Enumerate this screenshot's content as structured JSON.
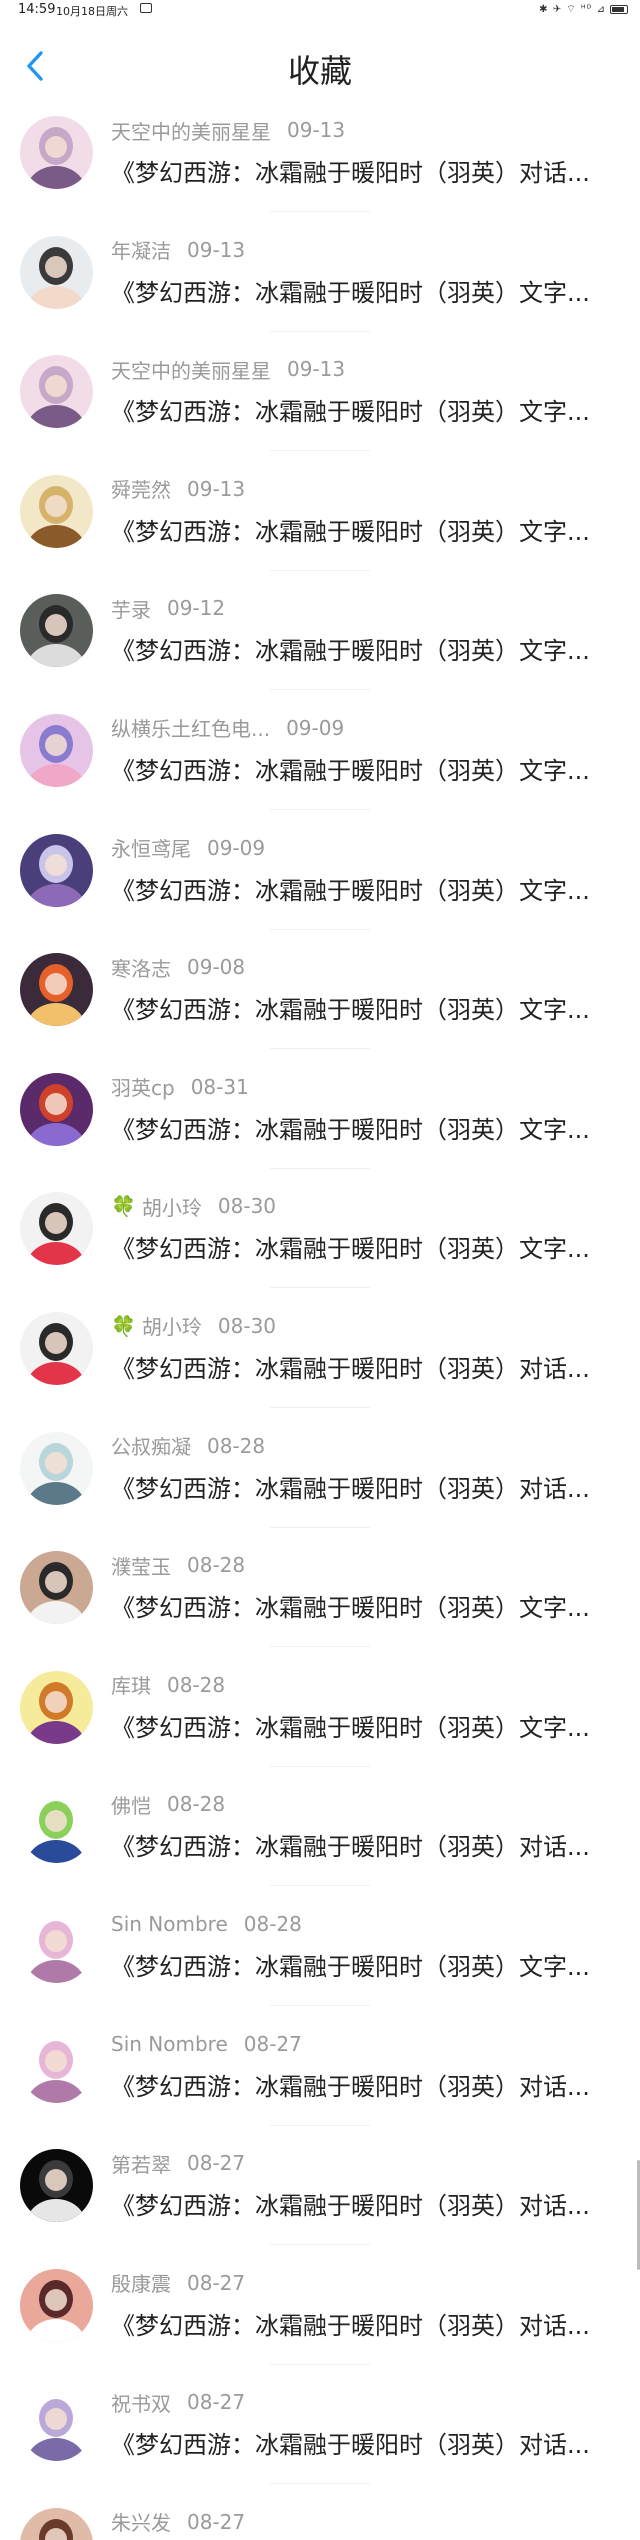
{
  "status": {
    "time": "14:59",
    "date": "10月18日周六",
    "right_icons": "✱ ✈ ⌔ ᴴᴰ ⊿"
  },
  "header": {
    "title": "收藏",
    "back_icon": "chevron-left-icon",
    "accent_color": "#2196F3"
  },
  "items": [
    {
      "name": "天空中的美丽星星",
      "date": "09-13",
      "text": "《梦幻西游：冰霜融于暖阳时（羽英）对话...",
      "clover": false,
      "palette": [
        "#f1dce8",
        "#c7a8c6",
        "#7a5a86"
      ]
    },
    {
      "name": "年凝洁",
      "date": "09-13",
      "text": "《梦幻西游：冰霜融于暖阳时（羽英）文字...",
      "clover": false,
      "palette": [
        "#e8ecee",
        "#3a3a3a",
        "#f2d9c9"
      ]
    },
    {
      "name": "天空中的美丽星星",
      "date": "09-13",
      "text": "《梦幻西游：冰霜融于暖阳时（羽英）文字...",
      "clover": false,
      "palette": [
        "#f1dce8",
        "#c7a8c6",
        "#7a5a86"
      ]
    },
    {
      "name": "舜莞然",
      "date": "09-13",
      "text": "《梦幻西游：冰霜融于暖阳时（羽英）文字...",
      "clover": false,
      "palette": [
        "#f2e7c6",
        "#d6b36a",
        "#8a5a2a"
      ]
    },
    {
      "name": "芋录",
      "date": "09-12",
      "text": "《梦幻西游：冰霜融于暖阳时（羽英）文字...",
      "clover": false,
      "palette": [
        "#5a5e5a",
        "#2a2a2a",
        "#dcdcdc"
      ]
    },
    {
      "name": "纵横乐土红色电...",
      "date": "09-09",
      "text": "《梦幻西游：冰霜融于暖阳时（羽英）文字...",
      "clover": false,
      "palette": [
        "#e6c4e8",
        "#8a7bd0",
        "#f0a7c8"
      ]
    },
    {
      "name": "永恒鸢尾",
      "date": "09-09",
      "text": "《梦幻西游：冰霜融于暖阳时（羽英）文字...",
      "clover": false,
      "palette": [
        "#4a3f7a",
        "#c9c5ea",
        "#8c6ab8"
      ]
    },
    {
      "name": "寒洛志",
      "date": "09-08",
      "text": "《梦幻西游：冰霜融于暖阳时（羽英）文字...",
      "clover": false,
      "palette": [
        "#3a2a3a",
        "#e5602a",
        "#f2c06a"
      ]
    },
    {
      "name": "羽英cp",
      "date": "08-31",
      "text": "《梦幻西游：冰霜融于暖阳时（羽英）文字...",
      "clover": false,
      "palette": [
        "#5a2a6a",
        "#d0412a",
        "#8a6ad0"
      ]
    },
    {
      "name": "胡小玲",
      "date": "08-30",
      "text": "《梦幻西游：冰霜融于暖阳时（羽英）文字...",
      "clover": true,
      "palette": [
        "#f2f2f2",
        "#2a2a2a",
        "#e2354a"
      ]
    },
    {
      "name": "胡小玲",
      "date": "08-30",
      "text": "《梦幻西游：冰霜融于暖阳时（羽英）对话...",
      "clover": true,
      "palette": [
        "#f2f2f2",
        "#2a2a2a",
        "#e2354a"
      ]
    },
    {
      "name": "公叔痴凝",
      "date": "08-28",
      "text": "《梦幻西游：冰霜融于暖阳时（羽英）对话...",
      "clover": false,
      "palette": [
        "#f4f6f6",
        "#b9d6da",
        "#5a7a8a"
      ]
    },
    {
      "name": "濮莹玉",
      "date": "08-28",
      "text": "《梦幻西游：冰霜融于暖阳时（羽英）文字...",
      "clover": false,
      "palette": [
        "#caa892",
        "#2a2a2a",
        "#f2f2f2"
      ]
    },
    {
      "name": "库琪",
      "date": "08-28",
      "text": "《梦幻西游：冰霜融于暖阳时（羽英）文字...",
      "clover": false,
      "palette": [
        "#f5eb9a",
        "#d07a2a",
        "#7a3a8a"
      ]
    },
    {
      "name": "佛恺",
      "date": "08-28",
      "text": "《梦幻西游：冰霜融于暖阳时（羽英）对话...",
      "clover": false,
      "palette": [
        "#ffffff",
        "#8ad05a",
        "#2a4a9a"
      ]
    },
    {
      "name": "Sin Nombre",
      "date": "08-28",
      "text": "《梦幻西游：冰霜融于暖阳时（羽英）文字...",
      "clover": false,
      "palette": [
        "#ffffff",
        "#e6b6d6",
        "#b07aa8"
      ]
    },
    {
      "name": "Sin Nombre",
      "date": "08-27",
      "text": "《梦幻西游：冰霜融于暖阳时（羽英）对话...",
      "clover": false,
      "palette": [
        "#ffffff",
        "#e6b6d6",
        "#b07aa8"
      ]
    },
    {
      "name": "第若翠",
      "date": "08-27",
      "text": "《梦幻西游：冰霜融于暖阳时（羽英）对话...",
      "clover": false,
      "palette": [
        "#0a0a0a",
        "#3a3a3a",
        "#e6e6e6"
      ]
    },
    {
      "name": "殷康震",
      "date": "08-27",
      "text": "《梦幻西游：冰霜融于暖阳时（羽英）对话...",
      "clover": false,
      "palette": [
        "#e9a89a",
        "#5a2a2a",
        "#ffffff"
      ]
    },
    {
      "name": "祝书双",
      "date": "08-27",
      "text": "《梦幻西游：冰霜融于暖阳时（羽英）对话...",
      "clover": false,
      "palette": [
        "#ffffff",
        "#b9a8d8",
        "#7a6aa8"
      ]
    },
    {
      "name": "朱兴发",
      "date": "08-27",
      "text": "",
      "clover": false,
      "palette": [
        "#e0bca8",
        "#6a3a2a",
        "#f4e2d8"
      ]
    }
  ],
  "clover_glyph": "🍀"
}
